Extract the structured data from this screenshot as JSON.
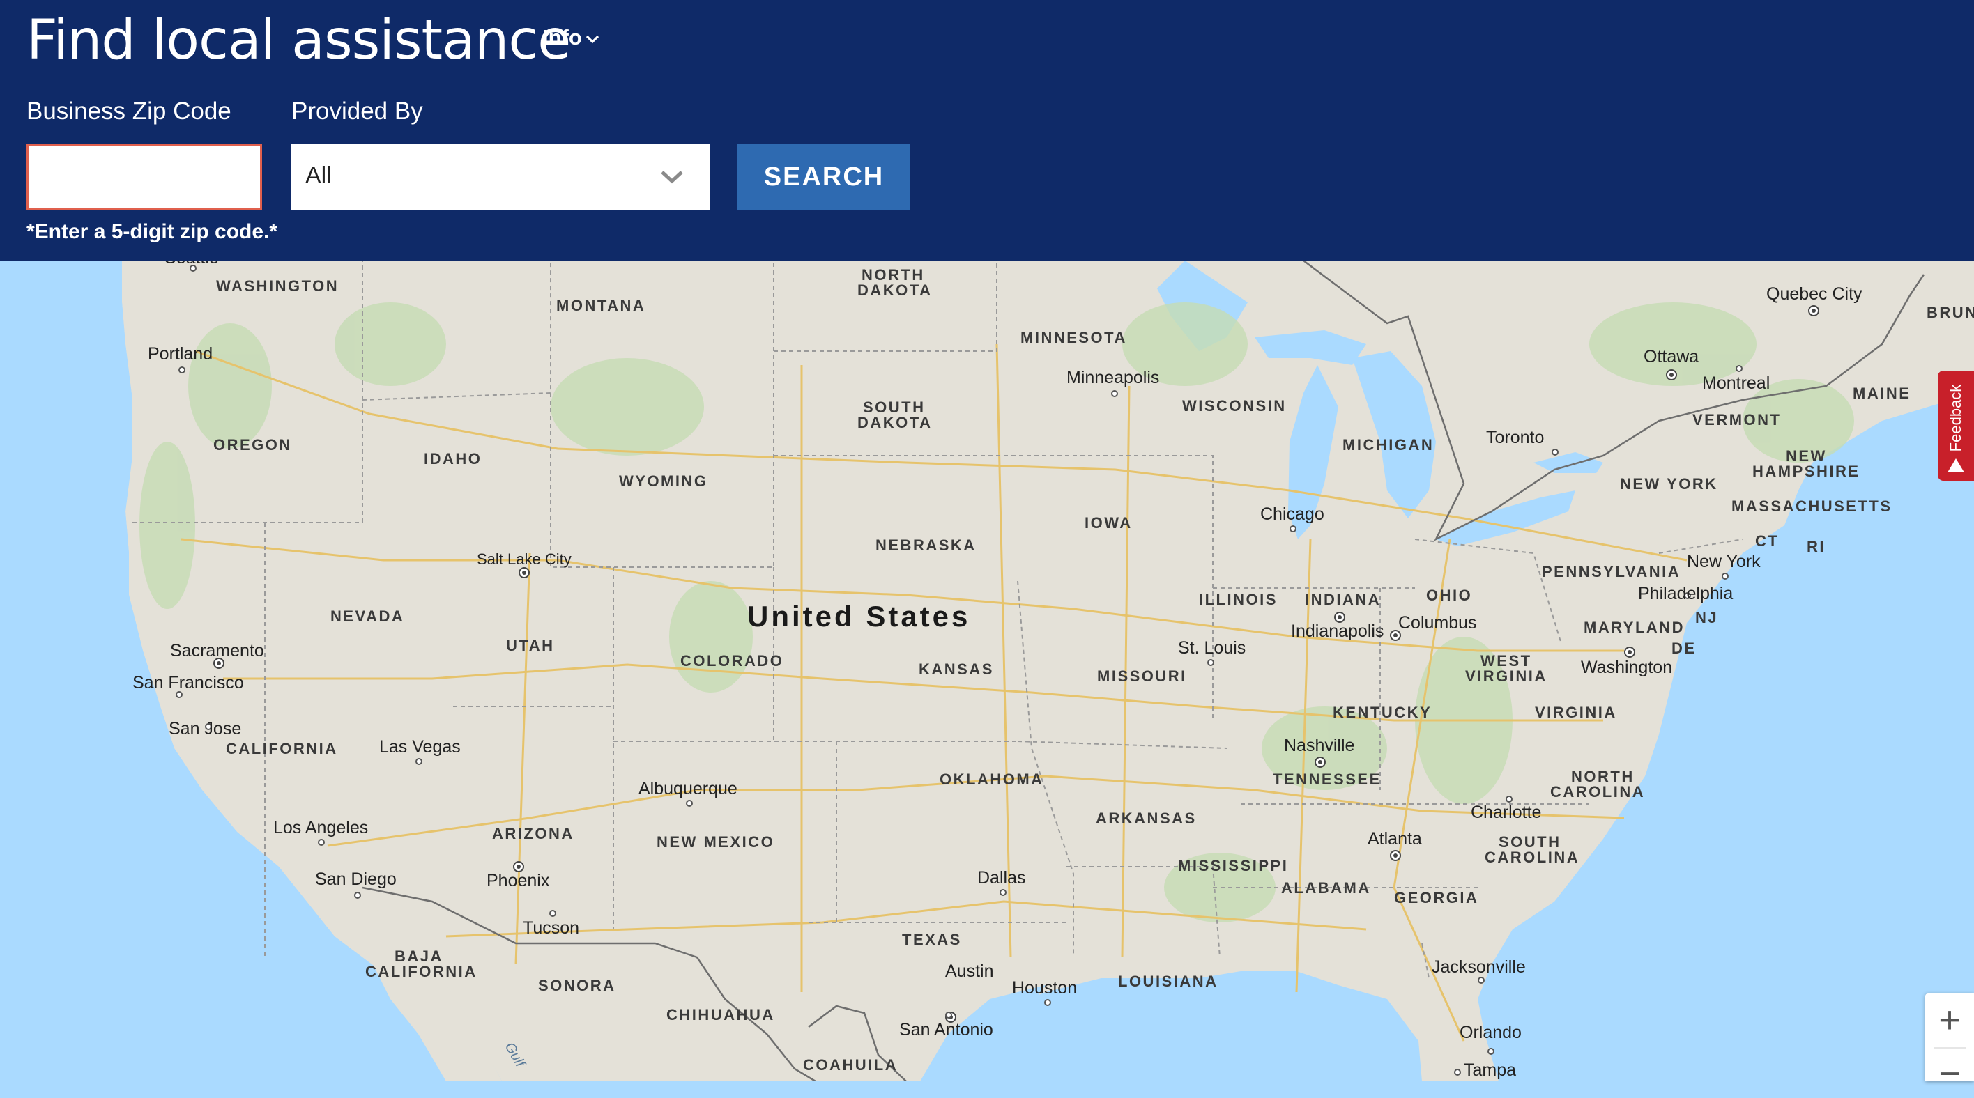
{
  "header": {
    "title": "Find local assistance",
    "info_label": "Info"
  },
  "form": {
    "zip_label": "Business Zip Code",
    "zip_value": "",
    "provider_label": "Provided By",
    "provider_selected": "All",
    "search_label": "SEARCH",
    "zip_error": "*Enter a 5-digit zip code.*"
  },
  "map": {
    "country_label": "United States",
    "states": {
      "washington": "WASHINGTON",
      "montana": "MONTANA",
      "north_dakota_1": "NORTH",
      "north_dakota_2": "DAKOTA",
      "minnesota": "MINNESOTA",
      "oregon": "OREGON",
      "idaho": "IDAHO",
      "wyoming": "WYOMING",
      "south_dakota_1": "SOUTH",
      "south_dakota_2": "DAKOTA",
      "wisconsin": "WISCONSIN",
      "michigan": "MICHIGAN",
      "iowa": "IOWA",
      "nebraska": "NEBRASKA",
      "nevada": "NEVADA",
      "utah": "UTAH",
      "colorado": "COLORADO",
      "kansas": "KANSAS",
      "missouri": "MISSOURI",
      "illinois": "ILLINOIS",
      "indiana": "INDIANA",
      "ohio": "OHIO",
      "pennsylvania": "PENNSYLVANIA",
      "new_york": "NEW YORK",
      "maine": "MAINE",
      "vermont": "VERMONT",
      "new_hampshire_1": "NEW",
      "new_hampshire_2": "HAMPSHIRE",
      "massachusetts": "MASSACHUSETTS",
      "ct": "CT",
      "ri": "RI",
      "nj": "NJ",
      "de": "DE",
      "maryland": "MARYLAND",
      "west_virginia_1": "WEST",
      "west_virginia_2": "VIRGINIA",
      "virginia": "VIRGINIA",
      "kentucky": "KENTUCKY",
      "tennessee": "TENNESSEE",
      "north_carolina_1": "NORTH",
      "north_carolina_2": "CAROLINA",
      "south_carolina_1": "SOUTH",
      "south_carolina_2": "CAROLINA",
      "georgia": "GEORGIA",
      "alabama": "ALABAMA",
      "mississippi": "MISSISSIPPI",
      "arkansas": "ARKANSAS",
      "louisiana": "LOUISIANA",
      "oklahoma": "OKLAHOMA",
      "texas": "TEXAS",
      "new_mexico": "NEW MEXICO",
      "arizona": "ARIZONA",
      "california": "CALIFORNIA",
      "baja_california_1": "BAJA",
      "baja_california_2": "CALIFORNIA",
      "sonora": "SONORA",
      "chihuahua": "CHIHUAHUA",
      "coahuila": "COAHUILA",
      "brunswick": "BRUN"
    },
    "cities": {
      "seattle": "Seattle",
      "portland": "Portland",
      "sacramento": "Sacramento",
      "san_francisco": "San Francisco",
      "san_jose": "San Jose",
      "los_angeles": "Los Angeles",
      "san_diego": "San Diego",
      "las_vegas": "Las Vegas",
      "phoenix": "Phoenix",
      "tucson": "Tucson",
      "salt_lake_city": "Salt Lake City",
      "albuquerque": "Albuquerque",
      "minneapolis": "Minneapolis",
      "chicago": "Chicago",
      "indianapolis": "Indianapolis",
      "columbus": "Columbus",
      "st_louis": "St. Louis",
      "nashville": "Nashville",
      "atlanta": "Atlanta",
      "charlotte": "Charlotte",
      "washington": "Washington",
      "philadelphia": "Philadelphia",
      "new_york": "New York",
      "toronto": "Toronto",
      "ottawa": "Ottawa",
      "montreal": "Montreal",
      "quebec_city": "Quebec City",
      "dallas": "Dallas",
      "austin": "Austin",
      "houston": "Houston",
      "san_antonio": "San Antonio",
      "jacksonville": "Jacksonville",
      "orlando": "Orlando",
      "tampa": "Tampa"
    },
    "water": {
      "gulf": "Gulf"
    }
  },
  "controls": {
    "feedback_label": "Feedback",
    "zoom_in": "+",
    "zoom_out": "−"
  },
  "colors": {
    "header_bg": "#0f2a68",
    "search_button": "#2e6ab1",
    "feedback_tab": "#c8202a",
    "water": "#aadaff",
    "land": "#e4e1d8",
    "error_border": "#e0604e"
  }
}
